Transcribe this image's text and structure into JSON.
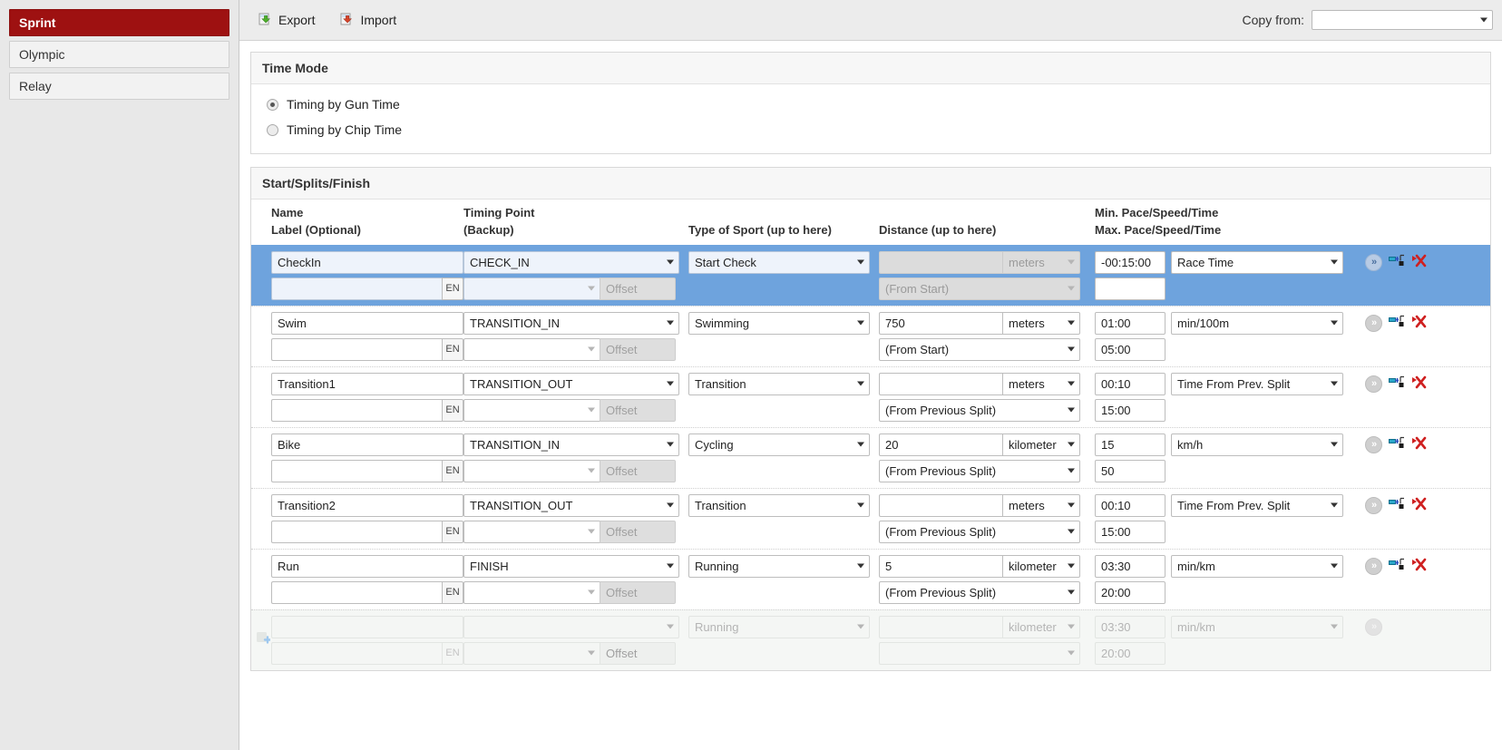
{
  "sidebar": {
    "items": [
      {
        "label": "Sprint",
        "active": true
      },
      {
        "label": "Olympic",
        "active": false
      },
      {
        "label": "Relay",
        "active": false
      }
    ]
  },
  "toolbar": {
    "export_label": "Export",
    "import_label": "Import",
    "export_icon": "export-green-arrow-icon",
    "import_icon": "import-red-arrow-icon",
    "copy_from_label": "Copy from:",
    "copy_from_value": "",
    "copy_from_placeholder": ""
  },
  "time_mode": {
    "title": "Time Mode",
    "options": [
      {
        "label": "Timing by Gun Time",
        "selected": true
      },
      {
        "label": "Timing by Chip Time",
        "selected": false
      }
    ]
  },
  "splits": {
    "title": "Start/Splits/Finish",
    "headers": {
      "name_line1": "Name",
      "name_line2": "Label (Optional)",
      "timing_point_line1": "Timing Point",
      "timing_point_line2": "(Backup)",
      "sport": "Type of Sport (up to here)",
      "distance": "Distance (up to here)",
      "pace_line1": "Min. Pace/Speed/Time",
      "pace_line2": "Max. Pace/Speed/Time"
    },
    "offset_placeholder": "Offset",
    "en_label": "EN",
    "rows": [
      {
        "selected": true,
        "disabled": false,
        "name": "CheckIn",
        "label": "",
        "timing_point": "CHECK_IN",
        "backup": "",
        "offset": "",
        "sport": "Start Check",
        "distance": "",
        "distance_unit": "meters",
        "distance_from": "(From Start)",
        "distance_disabled": true,
        "min_pace": "-00:15:00",
        "max_pace": "",
        "pace_unit": "Race Time"
      },
      {
        "selected": false,
        "disabled": false,
        "name": "Swim",
        "label": "",
        "timing_point": "TRANSITION_IN",
        "backup": "",
        "offset": "",
        "sport": "Swimming",
        "distance": "750",
        "distance_unit": "meters",
        "distance_from": "(From Start)",
        "distance_disabled": false,
        "min_pace": "01:00",
        "max_pace": "05:00",
        "pace_unit": "min/100m"
      },
      {
        "selected": false,
        "disabled": false,
        "name": "Transition1",
        "label": "",
        "timing_point": "TRANSITION_OUT",
        "backup": "",
        "offset": "",
        "sport": "Transition",
        "distance": "",
        "distance_unit": "meters",
        "distance_from": "(From Previous Split)",
        "distance_disabled": false,
        "min_pace": "00:10",
        "max_pace": "15:00",
        "pace_unit": "Time From Prev. Split"
      },
      {
        "selected": false,
        "disabled": false,
        "name": "Bike",
        "label": "",
        "timing_point": "TRANSITION_IN",
        "backup": "",
        "offset": "",
        "sport": "Cycling",
        "distance": "20",
        "distance_unit": "kilometer",
        "distance_from": "(From Previous Split)",
        "distance_disabled": false,
        "min_pace": "15",
        "max_pace": "50",
        "pace_unit": "km/h"
      },
      {
        "selected": false,
        "disabled": false,
        "name": "Transition2",
        "label": "",
        "timing_point": "TRANSITION_OUT",
        "backup": "",
        "offset": "",
        "sport": "Transition",
        "distance": "",
        "distance_unit": "meters",
        "distance_from": "(From Previous Split)",
        "distance_disabled": false,
        "min_pace": "00:10",
        "max_pace": "15:00",
        "pace_unit": "Time From Prev. Split"
      },
      {
        "selected": false,
        "disabled": false,
        "name": "Run",
        "label": "",
        "timing_point": "FINISH",
        "backup": "",
        "offset": "",
        "sport": "Running",
        "distance": "5",
        "distance_unit": "kilometer",
        "distance_from": "(From Previous Split)",
        "distance_disabled": false,
        "min_pace": "03:30",
        "max_pace": "20:00",
        "pace_unit": "min/km"
      },
      {
        "selected": false,
        "disabled": true,
        "name": "",
        "label": "",
        "timing_point": "",
        "backup": "",
        "offset": "",
        "sport": "Running",
        "distance": "",
        "distance_unit": "kilometer",
        "distance_from": "",
        "distance_disabled": true,
        "min_pace": "03:30",
        "max_pace": "20:00",
        "pace_unit": "min/km"
      }
    ],
    "actions": {
      "detail_icon": "double-chevron-right-icon",
      "insert_icon": "insert-split-icon",
      "delete_icon": "delete-split-icon",
      "add_icon": "add-split-icon"
    }
  }
}
